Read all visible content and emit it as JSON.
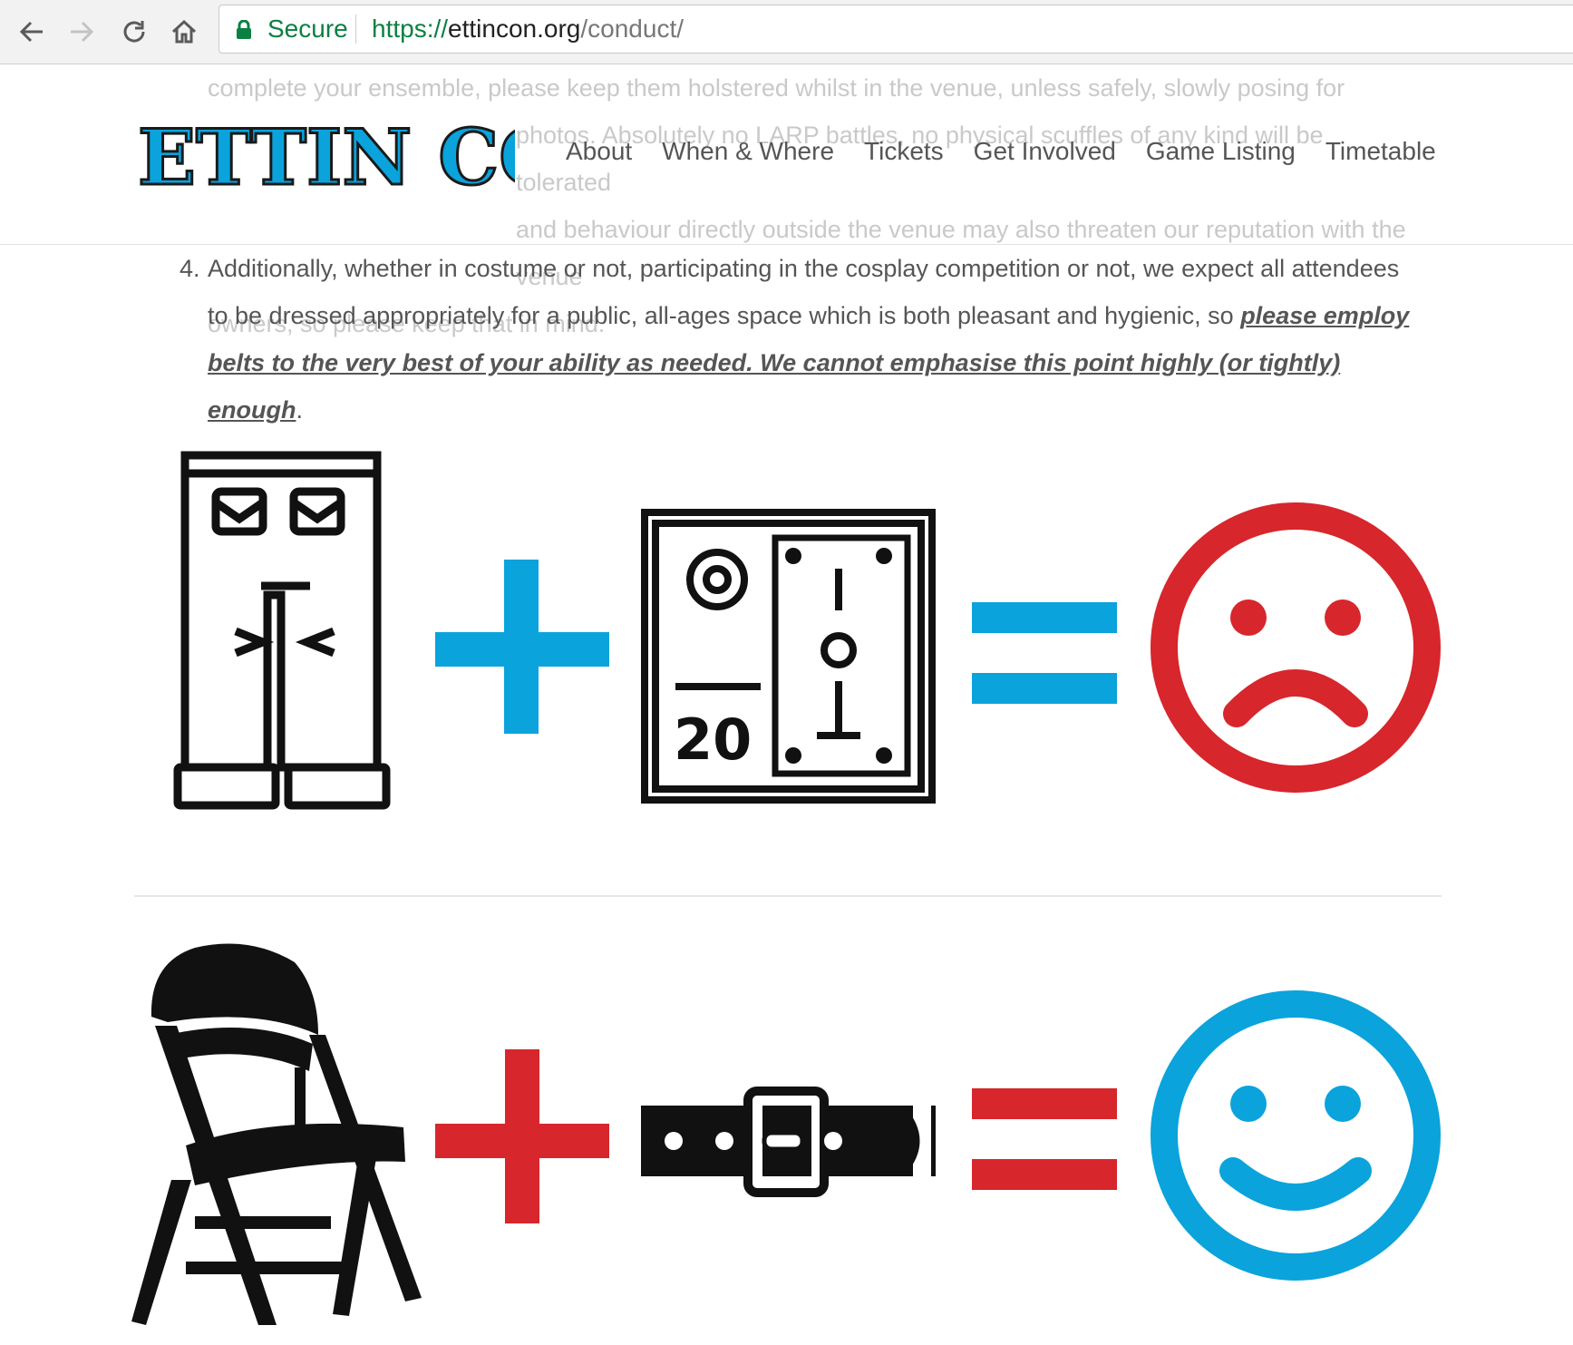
{
  "browser": {
    "secure_label": "Secure",
    "url_scheme": "https://",
    "url_host": "ettincon.org",
    "url_path": "/conduct/",
    "back_icon": "back-arrow-icon",
    "forward_icon": "forward-arrow-icon",
    "reload_icon": "reload-icon",
    "home_icon": "home-icon",
    "lock_icon": "lock-icon"
  },
  "site": {
    "logo_text": "ETTIN CON",
    "nav": [
      "About",
      "When & Where",
      "Tickets",
      "Get Involved",
      "Game Listing",
      "Timetable"
    ]
  },
  "content": {
    "faded_lines": [
      "complete your ensemble, please keep them holstered whilst in the venue, unless safely, slowly posing for",
      "photos. Absolutely no LARP battles, no physical scuffles of any kind will be tolerated",
      "and behaviour directly outside the venue may also threaten our reputation with the venue",
      "owners, so please keep that in mind."
    ],
    "item_number": "4.",
    "item_text": "Additionally, whether in costume or not, participating in the cosplay competition or not, we expect all attendees to be dressed appropriately for a public, all-ages space which is both pleasant and hygienic, so ",
    "item_emphasis": "please employ belts to the very best of your ability as needed. We cannot emphasise this point highly (or tightly) enough",
    "item_end": "."
  },
  "equations": {
    "row1": {
      "items": [
        "trousers-icon",
        "plus-icon",
        "money-note-icon",
        "equals-icon",
        "sad-face-icon"
      ],
      "operator_color": "#0aa3dc",
      "result_color": "#d7262c"
    },
    "row2": {
      "items": [
        "folding-chair-icon",
        "plus-icon",
        "belt-icon",
        "equals-icon",
        "happy-face-icon"
      ],
      "operator_color": "#d7262c",
      "result_color": "#0aa3dc"
    },
    "money_value": "20"
  }
}
